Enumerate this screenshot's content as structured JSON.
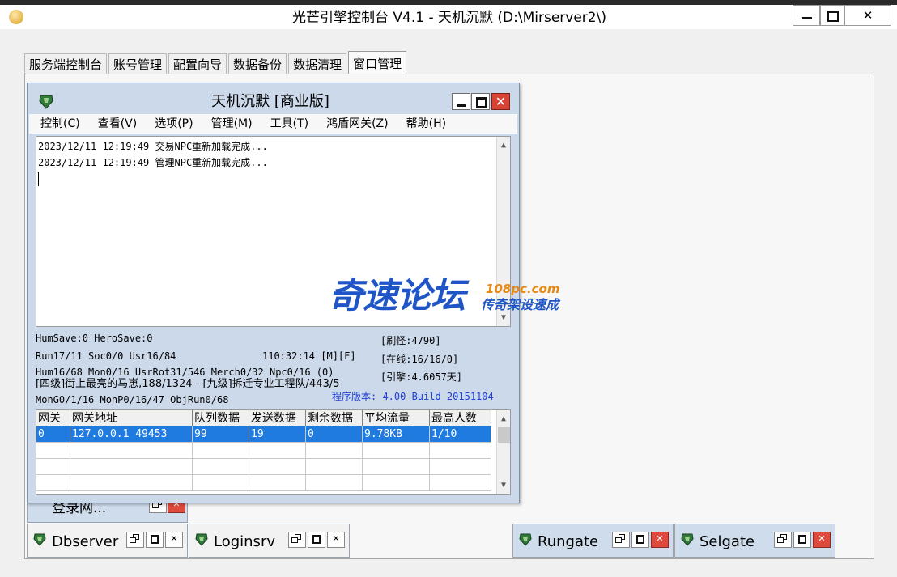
{
  "window": {
    "title": "光芒引擎控制台 V4.1 - 天机沉默 (D:\\Mirserver2\\)",
    "close_glyph": "✕"
  },
  "tabs": [
    {
      "label": "服务端控制台"
    },
    {
      "label": "账号管理"
    },
    {
      "label": "配置向导"
    },
    {
      "label": "数据备份"
    },
    {
      "label": "数据清理"
    },
    {
      "label": "窗口管理",
      "active": true
    }
  ],
  "child": {
    "title": "天机沉默 [商业版]",
    "close_glyph": "✕",
    "menu": [
      {
        "label": "控制(C)"
      },
      {
        "label": "查看(V)"
      },
      {
        "label": "选项(P)"
      },
      {
        "label": "管理(M)"
      },
      {
        "label": "工具(T)"
      },
      {
        "label": "鸿盾网关(Z)"
      },
      {
        "label": "帮助(H)"
      }
    ],
    "log": [
      "2023/12/11 12:19:49 交易NPC重新加载完成...",
      "2023/12/11 12:19:49 管理NPC重新加载完成..."
    ],
    "status": {
      "line1": "HumSave:0 HeroSave:0",
      "line2": "Run17/11 Soc0/0 Usr16/84",
      "time": "110:32:14 [M][F]",
      "line3": "Hum16/68 Mon0/16 UsrRot31/546 Merch0/32 Npc0/16 (0)",
      "line4": "[四级]街上最亮的马崽,188/1324 - [九级]拆迁专业工程队/443/5",
      "line5": "MonG0/1/16 MonP0/16/47 ObjRun0/68",
      "refresh": "[刷怪:4790]",
      "online": "[在线:16/16/0]",
      "engine": "[引擎:4.6057天]",
      "version": "程序版本: 4.00 Build 20151104"
    },
    "grid": {
      "headers": [
        "网关",
        "网关地址",
        "队列数据",
        "发送数据",
        "剩余数据",
        "平均流量",
        "最高人数"
      ],
      "rows": [
        [
          "0",
          "127.0.0.1 49453",
          "99",
          "19",
          "0",
          "9.78KB",
          "1/10"
        ]
      ]
    }
  },
  "watermark": {
    "cn": "奇速论坛",
    "url": "108pc.com",
    "sub": "传奇架设速成"
  },
  "mini_windows": [
    {
      "label": "登录网..."
    },
    {
      "label": "Dbserver"
    },
    {
      "label": "Loginsrv"
    },
    {
      "label": "Rungate"
    },
    {
      "label": "Selgate"
    }
  ],
  "mini_close_glyph": "✕",
  "colors": {
    "selection": "#1f7be0",
    "mdi_blue": "#ccd9ea",
    "close_red": "#d94336",
    "watermark_blue": "#1f55c6",
    "watermark_orange": "#e68a14"
  },
  "icons": {
    "app": "app-icon",
    "child": "server-icon",
    "minimize": "minimize-icon",
    "maximize": "maximize-icon",
    "restore": "restore-icon",
    "close": "close-icon"
  }
}
